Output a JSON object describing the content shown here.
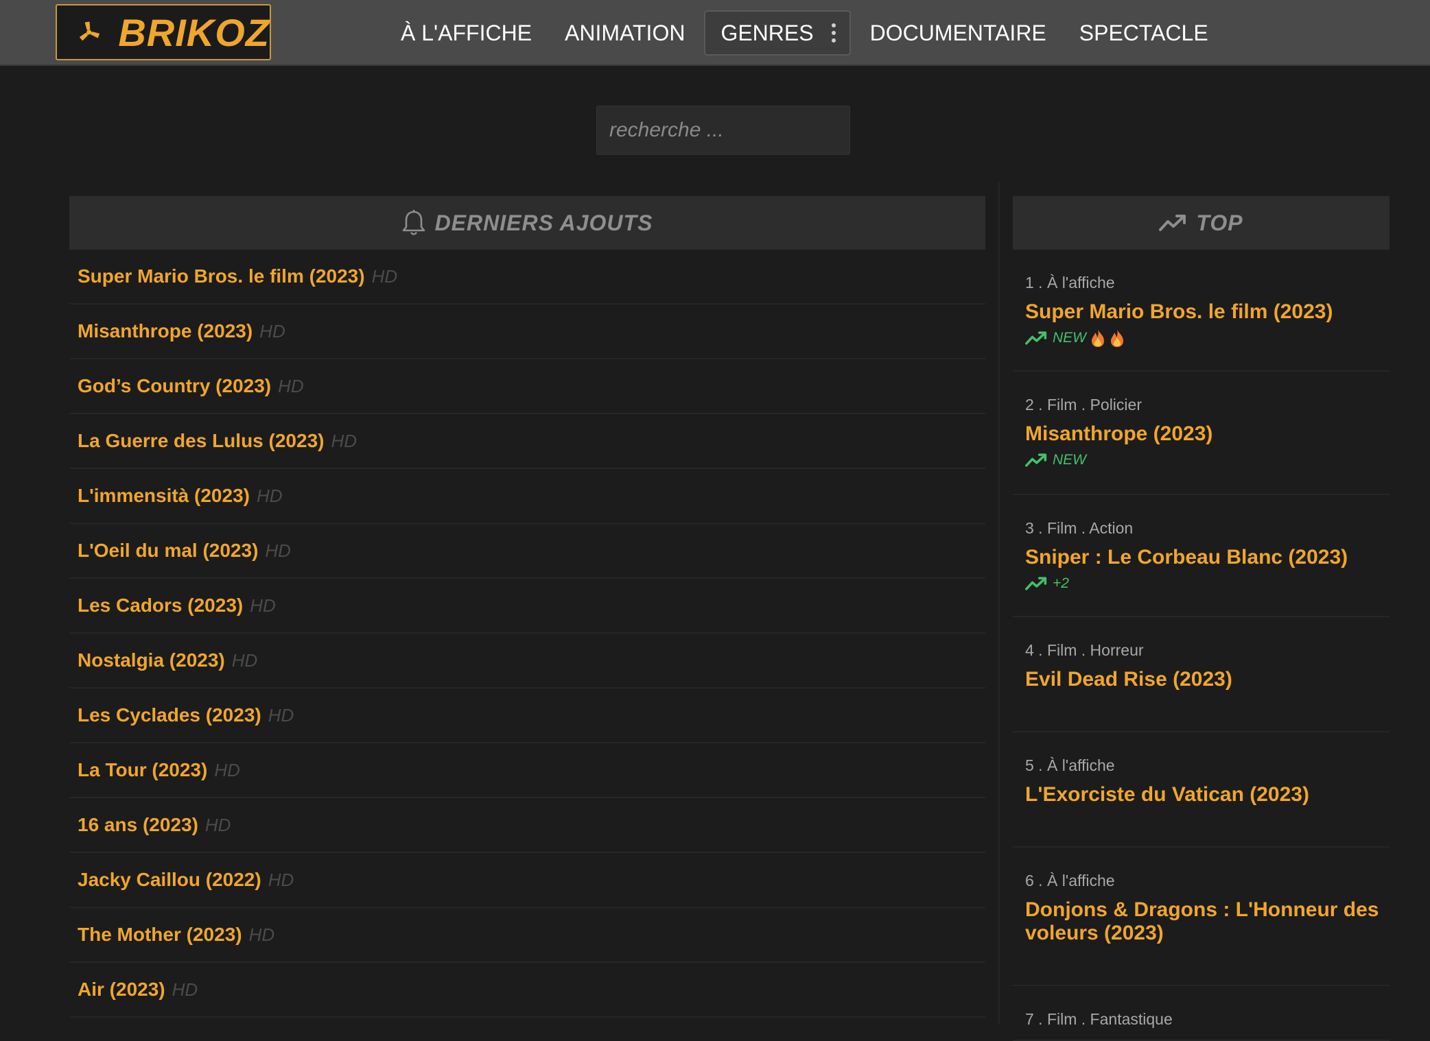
{
  "brand": {
    "name": "BRIKOZ",
    "icon": "radiation-icon",
    "accent_color": "#f0a62c"
  },
  "nav": {
    "items": [
      {
        "label": "À L'AFFICHE"
      },
      {
        "label": "ANIMATION"
      },
      {
        "label": "GENRES",
        "icon": "kebab-menu-icon"
      },
      {
        "label": "DOCUMENTAIRE"
      },
      {
        "label": "SPECTACLE"
      }
    ]
  },
  "search": {
    "placeholder": "recherche ..."
  },
  "latest": {
    "title": "DERNIERS AJOUTS",
    "icon": "bell-icon",
    "items": [
      {
        "title": "Super Mario Bros. le film (2023)",
        "quality": "HD"
      },
      {
        "title": "Misanthrope (2023)",
        "quality": "HD"
      },
      {
        "title": "God’s Country (2023)",
        "quality": "HD"
      },
      {
        "title": "La Guerre des Lulus (2023)",
        "quality": "HD"
      },
      {
        "title": "L'immensità (2023)",
        "quality": "HD"
      },
      {
        "title": "L'Oeil du mal (2023)",
        "quality": "HD"
      },
      {
        "title": "Les Cadors (2023)",
        "quality": "HD"
      },
      {
        "title": "Nostalgia (2023)",
        "quality": "HD"
      },
      {
        "title": "Les Cyclades (2023)",
        "quality": "HD"
      },
      {
        "title": "La Tour (2023)",
        "quality": "HD"
      },
      {
        "title": "16 ans (2023)",
        "quality": "HD"
      },
      {
        "title": "Jacky Caillou (2022)",
        "quality": "HD"
      },
      {
        "title": "The Mother (2023)",
        "quality": "HD"
      },
      {
        "title": "Air (2023)",
        "quality": "HD"
      }
    ]
  },
  "top": {
    "title": "TOP",
    "icon": "trending-up-icon",
    "badge_color": "#45c06a",
    "items": [
      {
        "meta": "1 . À l'affiche",
        "title": "Super Mario Bros. le film (2023)",
        "badge": "NEW",
        "flames": 2
      },
      {
        "meta": "2 . Film . Policier",
        "title": "Misanthrope (2023)",
        "badge": "NEW",
        "flames": 0
      },
      {
        "meta": "3 . Film . Action",
        "title": "Sniper : Le Corbeau Blanc (2023)",
        "badge": "+2",
        "flames": 0
      },
      {
        "meta": "4 . Film . Horreur",
        "title": "Evil Dead Rise (2023)",
        "badge": "",
        "flames": 0
      },
      {
        "meta": "5 . À l'affiche",
        "title": "L'Exorciste du Vatican (2023)",
        "badge": "",
        "flames": 0
      },
      {
        "meta": "6 . À l'affiche",
        "title": "Donjons & Dragons : L'Honneur des voleurs (2023)",
        "badge": "",
        "flames": 0
      },
      {
        "meta": "7 . Film . Fantastique",
        "title": "",
        "badge": "",
        "flames": 0
      }
    ]
  }
}
